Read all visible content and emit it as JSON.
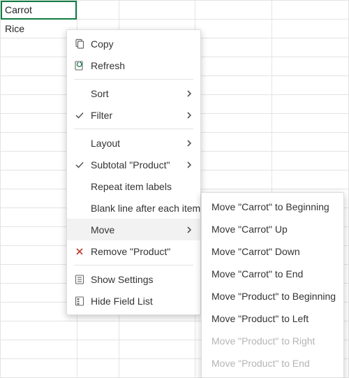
{
  "cells": {
    "a1": "Carrot",
    "a2": "Rice"
  },
  "menu": {
    "copy": "Copy",
    "refresh": "Refresh",
    "sort": "Sort",
    "filter": "Filter",
    "layout": "Layout",
    "subtotal": "Subtotal \"Product\"",
    "repeat": "Repeat item labels",
    "blankline": "Blank line after each item",
    "move": "Move",
    "remove": "Remove \"Product\"",
    "showsettings": "Show Settings",
    "hidefieldlist": "Hide Field List"
  },
  "submenu": {
    "beg": "Move \"Carrot\" to Beginning",
    "up": "Move \"Carrot\" Up",
    "down": "Move \"Carrot\" Down",
    "end": "Move \"Carrot\" to End",
    "pbeg": "Move \"Product\" to Beginning",
    "pleft": "Move \"Product\" to Left",
    "pright": "Move \"Product\" to Right",
    "pend": "Move \"Product\" to End"
  }
}
